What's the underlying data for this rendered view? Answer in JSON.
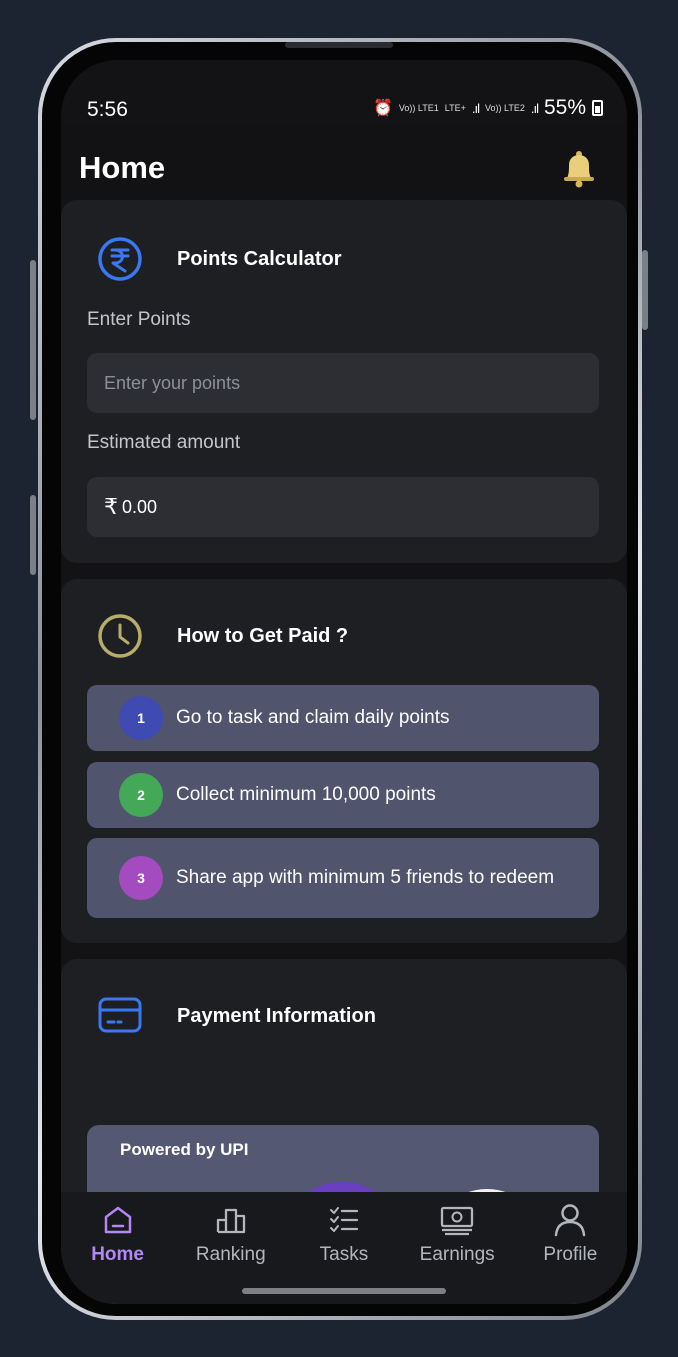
{
  "status_bar": {
    "time": "5:56",
    "sim1": "Vo)) LTE1",
    "lte": "LTE+",
    "sim2": "Vo)) LTE2",
    "battery": "55%"
  },
  "header": {
    "title": "Home",
    "bell_icon": "bell-icon"
  },
  "points_calculator": {
    "title": "Points Calculator",
    "enter_label": "Enter Points",
    "input_placeholder": "Enter your points",
    "input_value": "",
    "estimated_label": "Estimated amount",
    "currency_symbol": "₹",
    "estimated_value": "0.00"
  },
  "how_to_get_paid": {
    "title": "How to Get Paid ?",
    "steps": [
      {
        "num": "1",
        "text": "Go to task and claim daily points",
        "color": "#3f4bb3"
      },
      {
        "num": "2",
        "text": "Collect minimum 10,000 points",
        "color": "#43a857"
      },
      {
        "num": "3",
        "text": "Share app with minimum 5 friends to redeem",
        "color": "#a44bbf"
      }
    ]
  },
  "payment_information": {
    "title": "Payment Information",
    "powered_by": "Powered by UPI"
  },
  "bottom_nav": {
    "items": [
      {
        "label": "Home",
        "icon": "home-icon",
        "active": true
      },
      {
        "label": "Ranking",
        "icon": "ranking-icon",
        "active": false
      },
      {
        "label": "Tasks",
        "icon": "tasks-icon",
        "active": false
      },
      {
        "label": "Earnings",
        "icon": "earnings-icon",
        "active": false
      },
      {
        "label": "Profile",
        "icon": "profile-icon",
        "active": false
      }
    ]
  },
  "colors": {
    "accent": "#b388f5",
    "rupee_icon": "#3a78f2",
    "clock_icon": "#b6ad6b",
    "card_icon": "#3a78f2"
  }
}
